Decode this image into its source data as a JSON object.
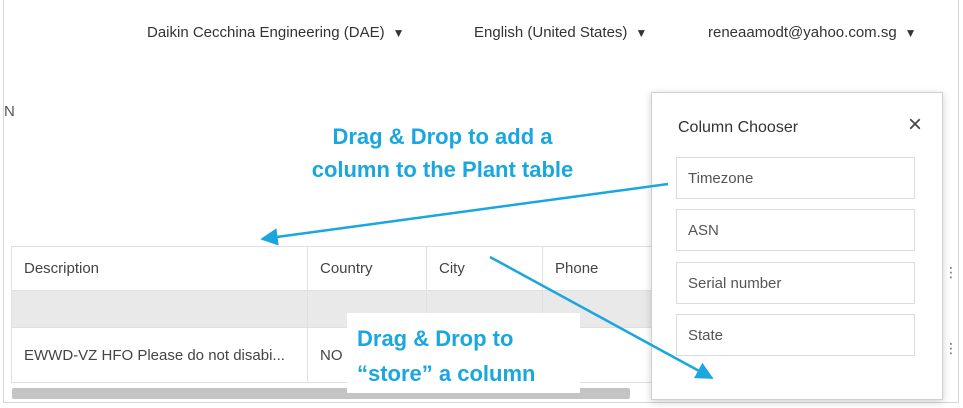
{
  "header": {
    "company": "Daikin Cecchina Engineering (DAE)",
    "language": "English (United States)",
    "user": "reneaamodt@yahoo.com.sg",
    "caret": "▼"
  },
  "left_fragment": "N",
  "annotations": {
    "add_line1": "Drag & Drop to add a",
    "add_line2": "column to the Plant table",
    "store_line1": "Drag & Drop to",
    "store_line2": "“store” a column",
    "color": "#1aa6de"
  },
  "table": {
    "columns": [
      "Description",
      "Country",
      "City",
      "Phone"
    ],
    "rows": [
      [
        "EWWD-VZ HFO Please do not disabi...",
        "NO",
        "",
        ""
      ]
    ]
  },
  "column_chooser": {
    "title": "Column Chooser",
    "close_icon": "×",
    "items": [
      "Timezone",
      "ASN",
      "Serial number",
      "State"
    ]
  }
}
